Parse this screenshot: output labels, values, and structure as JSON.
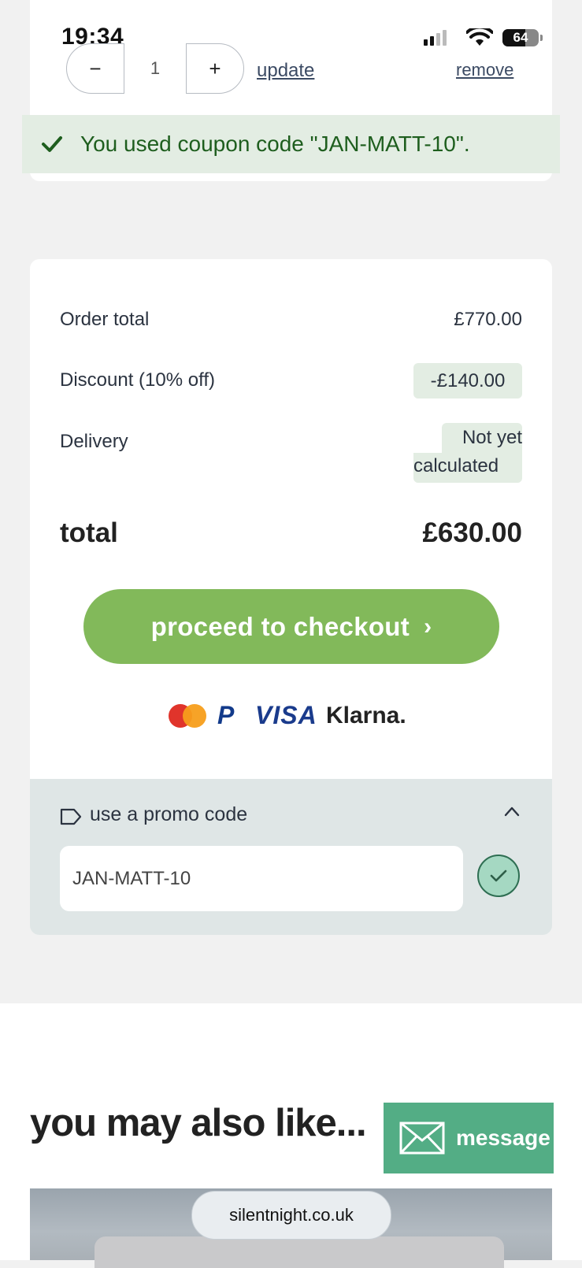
{
  "status_bar": {
    "time": "19:34",
    "battery_level": "64"
  },
  "cart_item": {
    "quantity": "1",
    "minus_symbol": "−",
    "plus_symbol": "+",
    "update_label": "update",
    "remove_label": "remove"
  },
  "coupon_notice": {
    "text": "You used coupon code \"JAN-MATT-10\"."
  },
  "summary": {
    "order_total_label": "Order total",
    "order_total_value": "£770.00",
    "discount_label": "Discount (10% off)",
    "discount_value": "-£140.00",
    "delivery_label": "Delivery",
    "delivery_value_line1": "Not yet",
    "delivery_value_line2": "calculated",
    "total_label": "total",
    "total_value": "£630.00"
  },
  "checkout": {
    "button_label": "proceed to checkout",
    "chevron": "›"
  },
  "payment_methods": [
    "mastercard",
    "paypal",
    "VISA",
    "Klarna."
  ],
  "promo": {
    "label": "use a promo code",
    "input_value": "JAN-MATT-10"
  },
  "recommendations": {
    "heading": "you may also like..."
  },
  "chat_widget": {
    "label": "message"
  },
  "browser": {
    "url": "silentnight.co.uk"
  },
  "colors": {
    "accent_green": "#82b95a",
    "coupon_bg": "#e3ede3",
    "coupon_text": "#1e5e1e",
    "message_green": "#53ad85",
    "promo_bg": "#dfe6e6"
  }
}
